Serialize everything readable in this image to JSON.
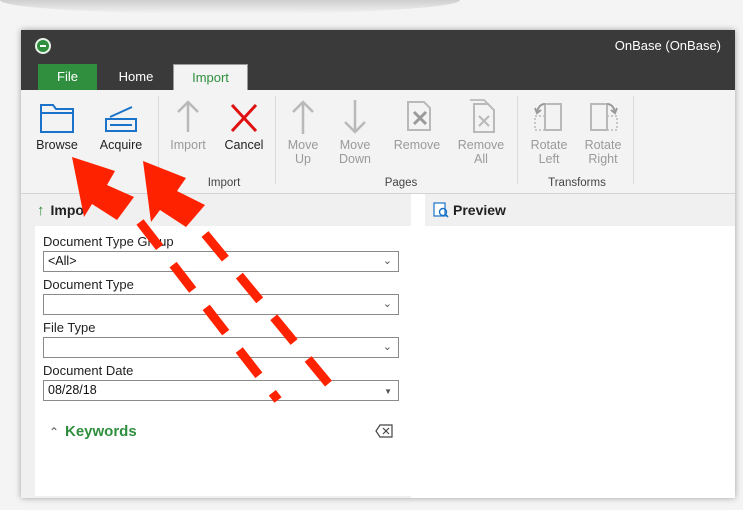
{
  "window": {
    "title": "OnBase (OnBase)"
  },
  "tabs": [
    {
      "label": "File"
    },
    {
      "label": "Home"
    },
    {
      "label": "Import"
    }
  ],
  "ribbon": {
    "buttons": [
      {
        "label": "Browse",
        "icon": "folder-icon",
        "enabled": true
      },
      {
        "label": "Acquire",
        "icon": "scanner-icon",
        "enabled": true
      },
      {
        "label": "Import",
        "icon": "arrow-up-icon",
        "enabled": false
      },
      {
        "label": "Cancel",
        "icon": "close-x-icon",
        "enabled": true
      },
      {
        "label_line1": "Move",
        "label_line2": "Up",
        "icon": "arrow-up-icon",
        "enabled": false
      },
      {
        "label_line1": "Move",
        "label_line2": "Down",
        "icon": "arrow-down-icon",
        "enabled": false
      },
      {
        "label": "Remove",
        "icon": "remove-page-icon",
        "enabled": false
      },
      {
        "label_line1": "Remove",
        "label_line2": "All",
        "icon": "remove-all-pages-icon",
        "enabled": false
      },
      {
        "label_line1": "Rotate",
        "label_line2": "Left",
        "icon": "rotate-left-icon",
        "enabled": false
      },
      {
        "label_line1": "Rotate",
        "label_line2": "Right",
        "icon": "rotate-right-icon",
        "enabled": false
      }
    ],
    "groups": [
      {
        "label": "Im"
      },
      {
        "label": "Import"
      },
      {
        "label": "Pages"
      },
      {
        "label": "Transforms"
      }
    ]
  },
  "import_panel": {
    "title": "Impo",
    "document_type_group": {
      "label": "Document Type Group",
      "value": "<All>"
    },
    "document_type": {
      "label": "Document Type",
      "value": ""
    },
    "file_type": {
      "label": "File Type",
      "value": ""
    },
    "document_date": {
      "label": "Document Date",
      "value": "08/28/18"
    },
    "keywords": {
      "label": "Keywords"
    }
  },
  "preview_panel": {
    "title": "Preview"
  },
  "colors": {
    "accent_green": "#2f8f3e",
    "titlebar": "#3a3a3a",
    "annotation_red": "#ff2200",
    "cancel_red": "#e01010",
    "icon_blue": "#1a73c8"
  }
}
